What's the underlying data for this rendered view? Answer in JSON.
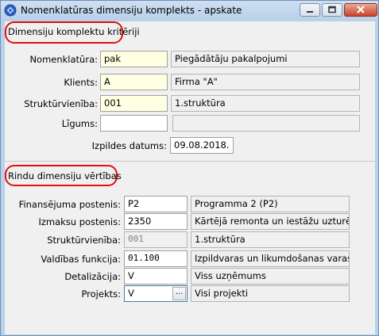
{
  "window": {
    "title": "Nomenklatūras dimensiju komplekts - apskate",
    "buttons": {
      "minimize": "—",
      "maximize": "□",
      "close": "✕"
    }
  },
  "criteria": {
    "title": "Dimensiju komplektu kritēriji",
    "nomenclature": {
      "label": "Nomenklatūra:",
      "code": "pak",
      "name": "Piegādātāju pakalpojumi"
    },
    "client": {
      "label": "Klients:",
      "code": "A",
      "name": "Firma \"A\""
    },
    "structure": {
      "label": "Struktūrvienība:",
      "code": "001",
      "name": "1.struktūra"
    },
    "contract": {
      "label": "Līgums:",
      "code": "",
      "name": ""
    },
    "exec_date": {
      "label": "Izpildes datums:",
      "value": "09.08.2018."
    }
  },
  "rows": {
    "title": "Rindu dimensiju vērtības",
    "financing": {
      "label": "Finansējuma postenis:",
      "code": "P2",
      "name": "Programma 2 (P2)"
    },
    "expense": {
      "label": "Izmaksu postenis:",
      "code": "2350",
      "name": "Kārtējā remonta un iestāžu uzturēšanas"
    },
    "structure": {
      "label": "Struktūrvienība:",
      "code": "001",
      "name": "1.struktūra"
    },
    "gov_function": {
      "label": "Valdības funkcija:",
      "code": "01.100",
      "name": "Izpildvaras un likumdošanas varas institū"
    },
    "detail": {
      "label": "Detalizācija:",
      "code": "V",
      "name": "Viss uzņēmums"
    },
    "project": {
      "label": "Projekts:",
      "code": "V",
      "name": "Visi projekti",
      "button": "..."
    }
  },
  "colors": {
    "highlight": "#e01010",
    "required_field": "#ffffe1"
  }
}
